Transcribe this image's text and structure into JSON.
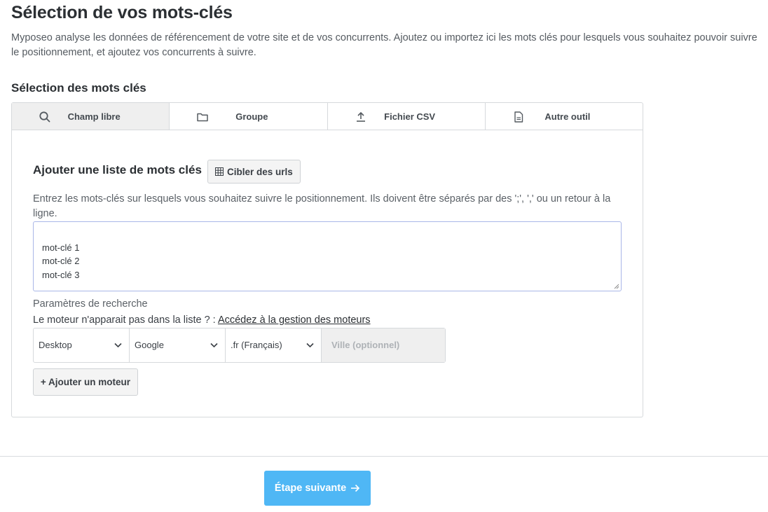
{
  "page": {
    "title": "Sélection de vos mots-clés",
    "intro": "Myposeo analyse les données de référencement de votre site et de vos concurrents. Ajoutez ou importez ici les mots clés pour lesquels vous souhaitez pouvoir suivre le positionnement, et ajoutez vos concurrents à suivre."
  },
  "keywords_section": {
    "title": "Sélection des mots clés",
    "tabs": [
      {
        "label": "Champ libre",
        "icon": "search-icon",
        "active": true
      },
      {
        "label": "Groupe",
        "icon": "folder-icon",
        "active": false
      },
      {
        "label": "Fichier CSV",
        "icon": "upload-icon",
        "active": false
      },
      {
        "label": "Autre outil",
        "icon": "document-icon",
        "active": false
      }
    ]
  },
  "free_field": {
    "title": "Ajouter une liste de mots clés",
    "target_urls_label": "Cibler des urls",
    "help_text": "Entrez les mots-clés sur lesquels vous souhaitez suivre le positionnement. Ils doivent être séparés par des ';', ',' ou un retour à la ligne.",
    "keywords_value": "mot-clé 1\nmot-clé 2\nmot-clé 3"
  },
  "search_params": {
    "label": "Paramètres de recherche",
    "engine_note": "Le moteur n'apparait pas dans la liste ? :",
    "engine_link": "Accédez à la gestion des moteurs",
    "device": "Desktop",
    "engine": "Google",
    "locale": ".fr (Français)",
    "city_placeholder": "Ville (optionnel)",
    "add_engine_label": "+ Ajouter un moteur"
  },
  "footer": {
    "next_label": "Étape suivante",
    "next_color": "#4fb7f5"
  }
}
